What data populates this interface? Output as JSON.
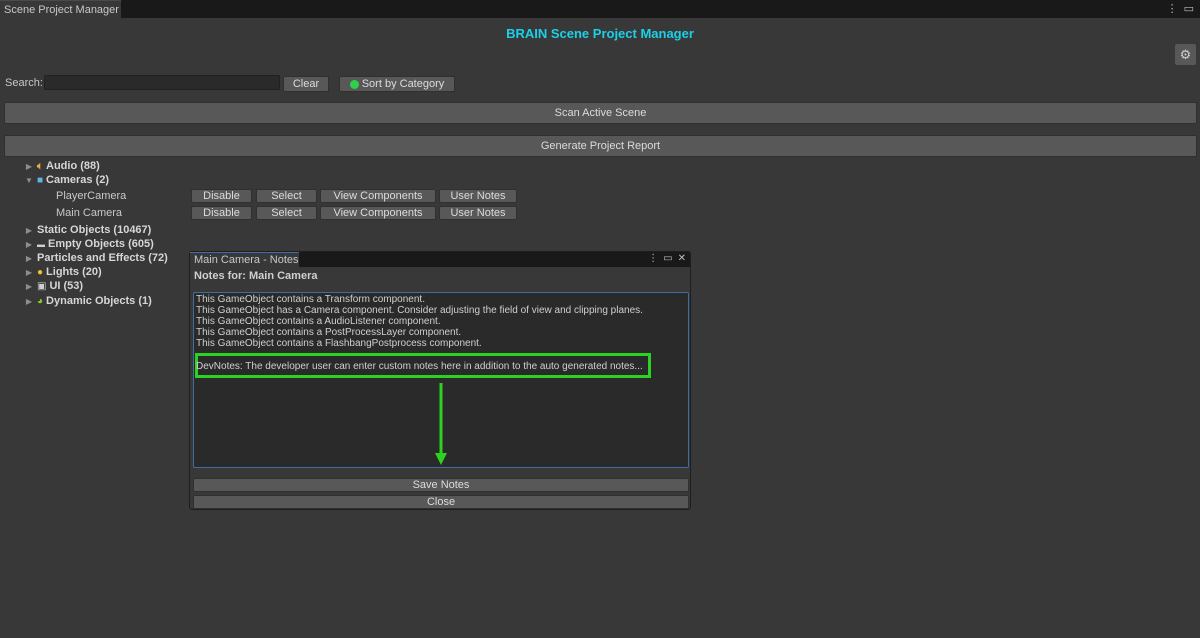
{
  "window": {
    "tab_title": "Scene Project Manager",
    "menu_icon": "kebab-menu-icon",
    "maximize_icon": "maximize-icon",
    "close_icon": "close-icon"
  },
  "app_title": "BRAIN Scene Project Manager",
  "settings_icon": "gear-icon",
  "search": {
    "label": "Search:",
    "value": "",
    "placeholder": ""
  },
  "buttons": {
    "clear": "Clear",
    "sort": "Sort by Category",
    "sort_indicator_color": "#2fd14a",
    "scan": "Scan Active Scene",
    "report": "Generate Project Report"
  },
  "tree": {
    "categories": [
      {
        "label": "Audio (88)",
        "icon": "audio-icon",
        "expanded": false
      },
      {
        "label": "Cameras (2)",
        "icon": "camera-icon",
        "expanded": true
      },
      {
        "label": "Static Objects (10467)",
        "icon": "",
        "expanded": false
      },
      {
        "label": "Empty Objects (605)",
        "icon": "folder-icon",
        "expanded": false
      },
      {
        "label": "Particles and Effects (72)",
        "icon": "",
        "expanded": false
      },
      {
        "label": "Lights (20)",
        "icon": "lightbulb-icon",
        "expanded": false
      },
      {
        "label": "UI (53)",
        "icon": "ui-rect-icon",
        "expanded": false
      },
      {
        "label": "Dynamic Objects (1)",
        "icon": "physics-icon",
        "expanded": false
      }
    ],
    "cameras": [
      {
        "name": "PlayerCamera"
      },
      {
        "name": "Main Camera"
      }
    ],
    "row_actions": {
      "disable": "Disable",
      "select": "Select",
      "view": "View Components",
      "notes": "User Notes"
    }
  },
  "notes_window": {
    "tab_title": "Main Camera - Notes",
    "heading": "Notes for: Main Camera",
    "lines": [
      "This GameObject contains a Transform component.",
      "This GameObject has a Camera component. Consider adjusting the field of view and clipping planes.",
      "This GameObject contains a AudioListener component.",
      "This GameObject contains a PostProcessLayer component.",
      "This GameObject contains a FlashbangPostprocess component."
    ],
    "dev_note": "DevNotes: The developer user can enter custom notes here in addition to the auto generated notes...",
    "highlight_color": "#2bd21f",
    "save": "Save Notes",
    "close": "Close"
  },
  "colors": {
    "title": "#1ad1e8",
    "background": "#383838",
    "button": "#585858"
  }
}
